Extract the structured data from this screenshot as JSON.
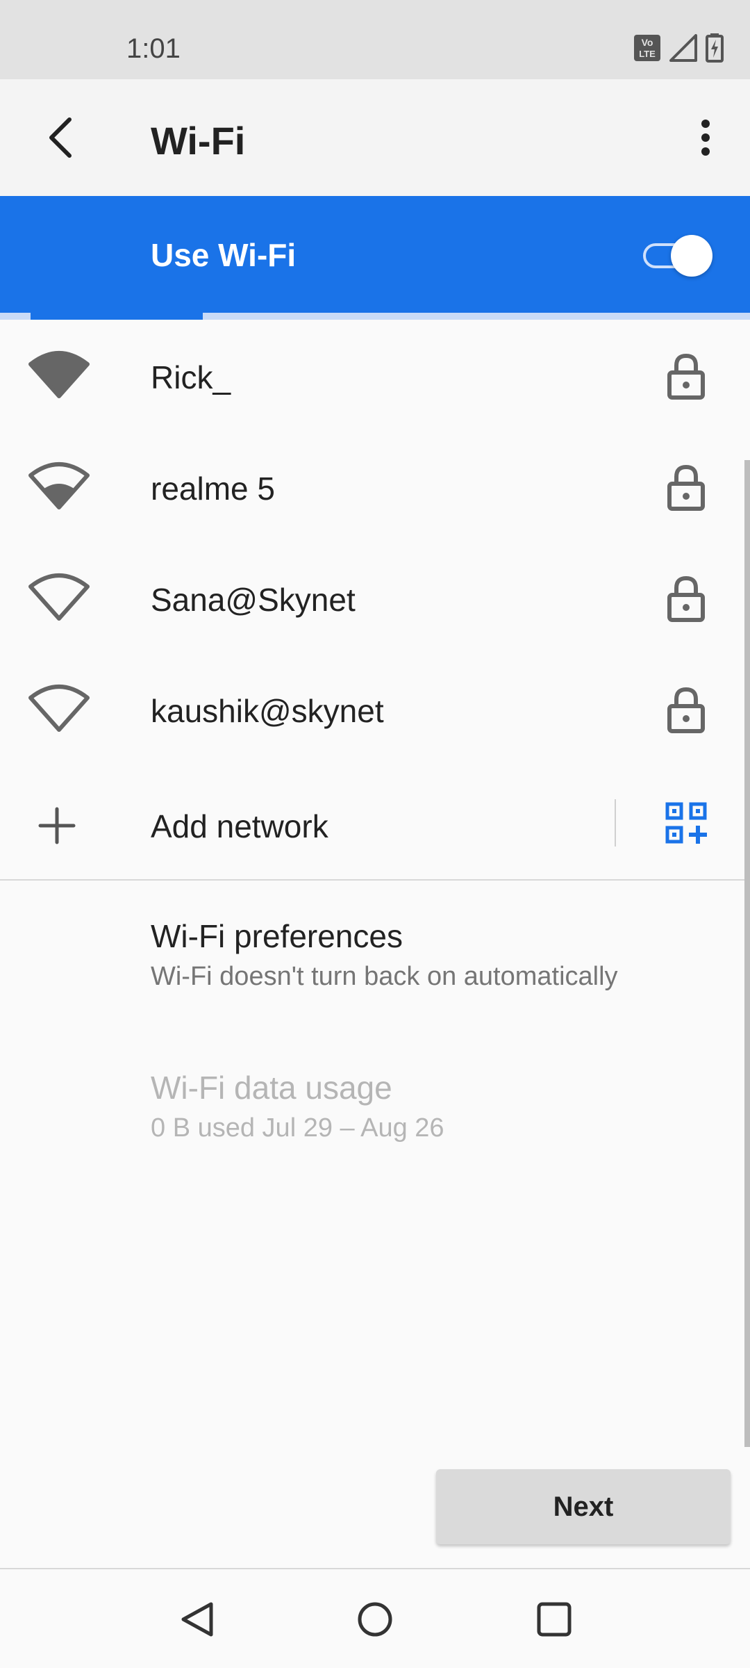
{
  "status_bar": {
    "time": "1:01",
    "icons": [
      "volte-icon",
      "signal-icon",
      "battery-charging-icon"
    ],
    "volte_line1": "Vo",
    "volte_line2": "LTE"
  },
  "app_bar": {
    "title": "Wi-Fi",
    "back_icon": "back-arrow-icon",
    "more_icon": "more-vert-icon"
  },
  "wifi_toggle": {
    "label": "Use Wi-Fi",
    "enabled": true,
    "accent_color": "#1a73e8"
  },
  "networks": [
    {
      "name": "Rick_",
      "signal": 3,
      "secured": true
    },
    {
      "name": "realme 5",
      "signal": 2,
      "secured": true
    },
    {
      "name": "Sana@Skynet",
      "signal": 0,
      "secured": true
    },
    {
      "name": "kaushik@skynet",
      "signal": 0,
      "secured": true
    }
  ],
  "add_network": {
    "label": "Add network",
    "qr_icon": "qr-scan-icon"
  },
  "preferences": {
    "title": "Wi-Fi preferences",
    "subtitle": "Wi-Fi doesn't turn back on automatically"
  },
  "data_usage": {
    "title": "Wi-Fi data usage",
    "subtitle": "0 B used Jul 29 – Aug 26",
    "disabled": true
  },
  "next_button": {
    "label": "Next"
  },
  "nav_bar": {
    "icons": [
      "nav-back-icon",
      "nav-home-icon",
      "nav-recents-icon"
    ]
  }
}
